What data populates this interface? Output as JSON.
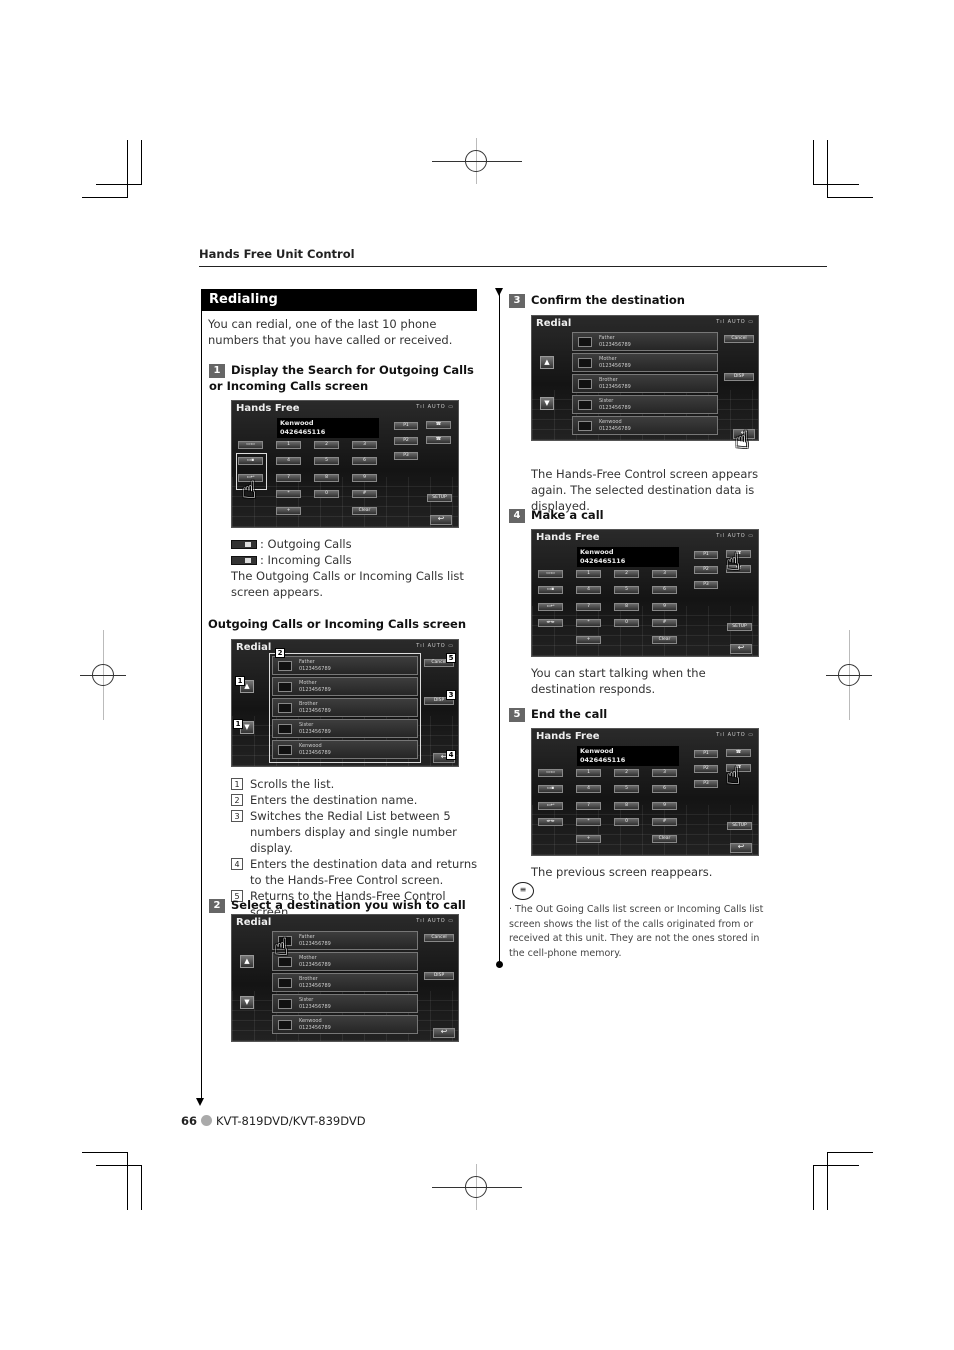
{
  "section_header": "Hands Free Unit Control",
  "title": "Redialing",
  "intro": "You can redial, one of the last 10 phone numbers that you have called or received.",
  "steps": [
    {
      "num": "1",
      "title": "Display the Search for Outgoing Calls or Incoming Calls screen"
    },
    {
      "num": "2",
      "title": "Select a destination you wish to call"
    },
    {
      "num": "3",
      "title": "Confirm the destination"
    },
    {
      "num": "4",
      "title": "Make a call"
    },
    {
      "num": "5",
      "title": "End the call"
    }
  ],
  "legend": {
    "outgoing": ": Outgoing Calls",
    "incoming": ": Incoming Calls",
    "result": "The Outgoing Calls or Incoming Calls list screen appears."
  },
  "subhead_list_screen": "Outgoing Calls or Incoming Calls screen",
  "callouts": [
    {
      "num": "1",
      "text": "Scrolls the list."
    },
    {
      "num": "2",
      "text": "Enters the destination name."
    },
    {
      "num": "3",
      "text": "Switches the Redial List between 5 numbers display and single number display."
    },
    {
      "num": "4",
      "text": "Enters the destination data and returns to the Hands-Free Control screen."
    },
    {
      "num": "5",
      "text": "Returns to the Hands-Free Control screen."
    }
  ],
  "step3_result": "The Hands-Free Control screen appears again. The selected destination data is displayed.",
  "step4_result": "You can start talking when the destination responds.",
  "step5_result": "The previous screen reappears.",
  "note": "The Out Going Calls list screen or Incoming Calls list screen shows the list of the calls originated from or received at this unit. They are not the ones stored in the cell-phone memory.",
  "footer": {
    "page": "66",
    "model": "KVT-819DVD/KVT-839DVD"
  },
  "hands_free_screen": {
    "title": "Hands Free",
    "status": "Tıl  AUTO  ▭",
    "display_name": "Kenwood",
    "display_number": "0426465116",
    "keys": [
      "1",
      "2",
      "3",
      "4",
      "5",
      "6",
      "7",
      "8",
      "9",
      "*",
      "0",
      "#",
      "+",
      "Clear"
    ],
    "presets": [
      "P1",
      "P2",
      "P3"
    ],
    "setup": "SETUP",
    "return_icon": "↩"
  },
  "redial_screen": {
    "title": "Redial",
    "status": "Tıl  AUTO  ▭",
    "cancel": "Cancel",
    "disp": "DISP",
    "up": "▲",
    "down": "▼",
    "return_icon": "↩",
    "entries": [
      {
        "name": "Father",
        "number": "0123456789"
      },
      {
        "name": "Mother",
        "number": "0123456789"
      },
      {
        "name": "Brother",
        "number": "0123456789"
      },
      {
        "name": "Sister",
        "number": "0123456789"
      },
      {
        "name": "Kenwood",
        "number": "0123456789"
      }
    ]
  },
  "icons": {
    "hand": "☝",
    "note": "≡"
  }
}
